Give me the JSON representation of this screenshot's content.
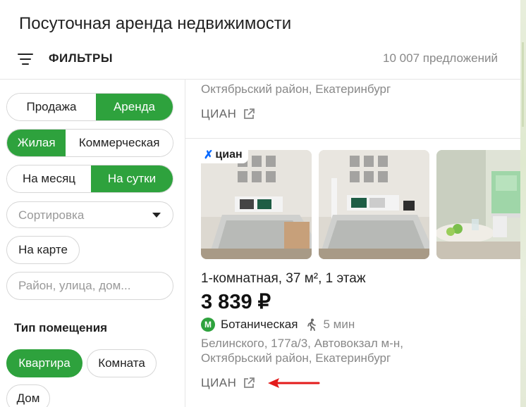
{
  "page": {
    "title": "Посуточная аренда недвижимости"
  },
  "filters": {
    "label": "ФИЛЬТРЫ",
    "offers_count": "10 007 предложений"
  },
  "sidebar": {
    "deal_type": [
      "Продажа",
      "Аренда"
    ],
    "property_class": [
      "Жилая",
      "Коммерческая"
    ],
    "term": [
      "На месяц",
      "На сутки"
    ],
    "sort_placeholder": "Сортировка",
    "map_button": "На карте",
    "location_placeholder": "Район, улица, дом...",
    "section_title": "Тип помещения",
    "room_types": [
      "Квартира",
      "Комната",
      "Дом"
    ]
  },
  "previous_listing": {
    "address": "Октябрьский район, Екатеринбург",
    "source": "ЦИАН"
  },
  "listing": {
    "badge": "циан",
    "title": "1-комнатная, 37 м², 1 этаж",
    "price": "3 839 ₽",
    "metro_icon_letter": "М",
    "metro": "Ботаническая",
    "walk_time": "5 мин",
    "address_line1": "Белинского, 177а/3, Автовокзал м-н,",
    "address_line2": "Октябрьский район, Екатеринбург",
    "source": "ЦИАН"
  },
  "icons": {
    "filter": "filter-lines-icon",
    "external": "external-link-icon",
    "metro": "metro-icon",
    "walk": "walking-person-icon",
    "dropdown": "chevron-down-icon"
  },
  "colors": {
    "accent": "#2ea23d",
    "cian_logo": "#0468ff",
    "arrow": "#e31b1b",
    "muted_text": "#888888"
  }
}
